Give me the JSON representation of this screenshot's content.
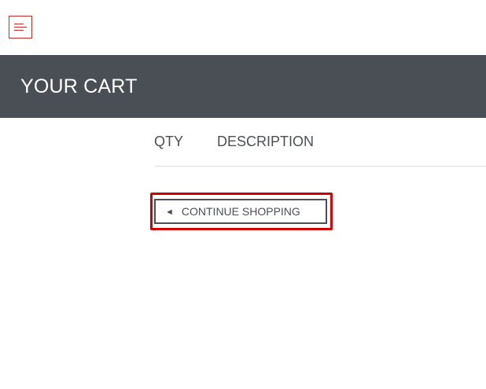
{
  "menu": {
    "icon": "hamburger-menu-icon",
    "accent_color": "#c62828"
  },
  "header": {
    "title": "YOUR CART",
    "background_color": "#4a4f56"
  },
  "cart_table": {
    "columns": [
      "QTY",
      "DESCRIPTION"
    ]
  },
  "continue_shopping": {
    "icon_glyph": "◄",
    "label": "CONTINUE SHOPPING",
    "highlight_color": "#d10000"
  }
}
